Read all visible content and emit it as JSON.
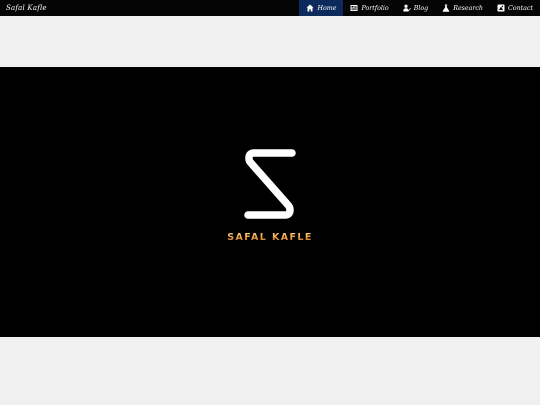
{
  "brand": "Safal Kafle",
  "nav": [
    {
      "label": "Home",
      "icon": "home-icon",
      "active": true
    },
    {
      "label": "Portfolio",
      "icon": "portfolio-icon",
      "active": false
    },
    {
      "label": "Blog",
      "icon": "blog-icon",
      "active": false
    },
    {
      "label": "Research",
      "icon": "flask-icon",
      "active": false
    },
    {
      "label": "Contact",
      "icon": "contact-icon",
      "active": false
    }
  ],
  "hero": {
    "logo_icon": "s-logo-icon",
    "name": "SAFAL KAFLE"
  },
  "colors": {
    "navbar": "#050505",
    "active_nav": "#0d2a5c",
    "hero_bg": "#000000",
    "name_gold": "#e08a2e",
    "page_bg": "#f0f0f0"
  }
}
